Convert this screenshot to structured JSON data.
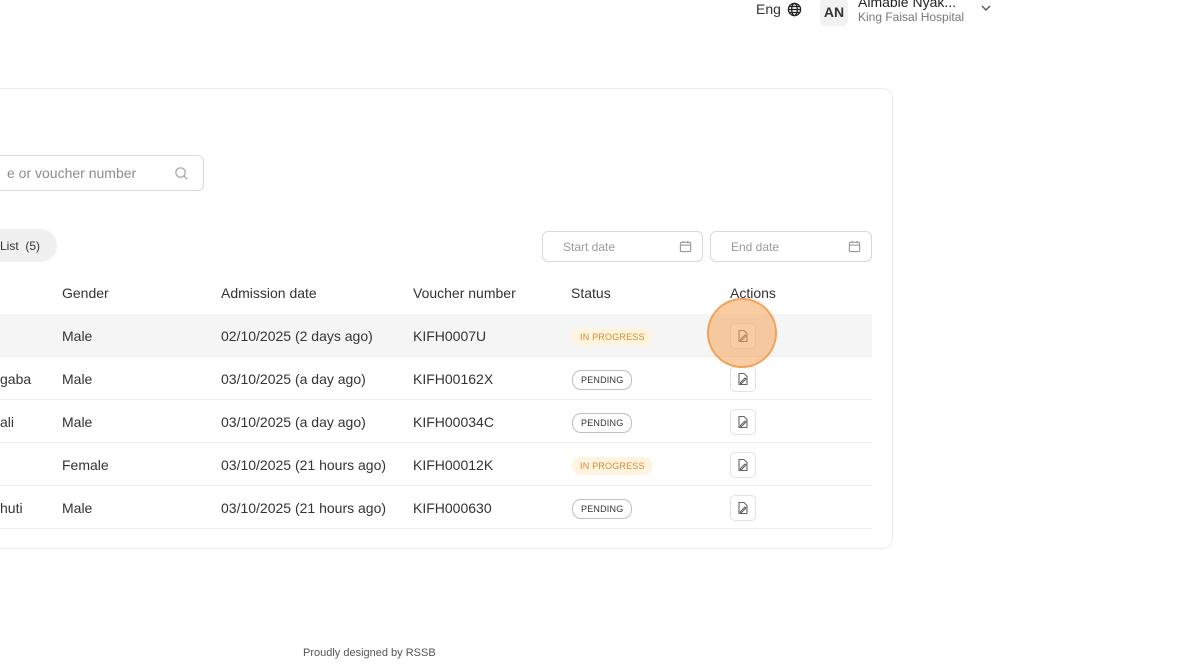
{
  "header": {
    "language": "Eng",
    "user_initials": "AN",
    "user_name": "Aimable Nyak...",
    "user_org": "King Faisal Hospital"
  },
  "search": {
    "placeholder": "e or voucher number"
  },
  "tabs": {
    "list_label": "List",
    "list_count": "(5)"
  },
  "filters": {
    "start_placeholder": "Start date",
    "end_placeholder": "End date"
  },
  "table": {
    "headers": {
      "gender": "Gender",
      "admission_date": "Admission date",
      "voucher_number": "Voucher number",
      "status": "Status",
      "actions": "Actions"
    },
    "rows": [
      {
        "name": "",
        "gender": "Male",
        "admission_date": "02/10/2025 (2 days ago)",
        "voucher": "KIFH0007U",
        "status": "IN PROGRESS"
      },
      {
        "name": "gaba",
        "gender": "Male",
        "admission_date": "03/10/2025 (a day ago)",
        "voucher": "KIFH00162X",
        "status": "PENDING"
      },
      {
        "name": "ali",
        "gender": "Male",
        "admission_date": "03/10/2025 (a day ago)",
        "voucher": "KIFH00034C",
        "status": "PENDING"
      },
      {
        "name": "",
        "gender": "Female",
        "admission_date": "03/10/2025 (21 hours ago)",
        "voucher": "KIFH00012K",
        "status": "IN PROGRESS"
      },
      {
        "name": "huti",
        "gender": "Male",
        "admission_date": "03/10/2025 (21 hours ago)",
        "voucher": "KIFH000630",
        "status": "PENDING"
      }
    ]
  },
  "footer": {
    "text": "Proudly designed by RSSB"
  },
  "colors": {
    "in_progress_text": "#d9892b",
    "in_progress_bg": "#fff4e0",
    "click_indicator": "#f4a259"
  },
  "icons": [
    "globe-icon",
    "chevron-down-icon",
    "search-icon",
    "calendar-icon",
    "document-icon"
  ]
}
